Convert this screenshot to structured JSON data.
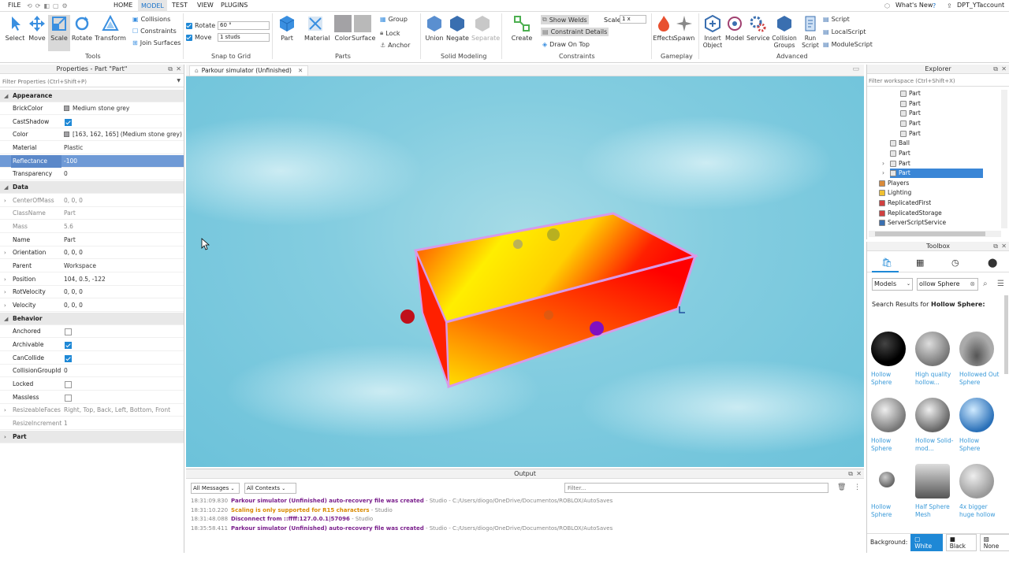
{
  "menu": {
    "file": "FILE",
    "home": "HOME",
    "model": "MODEL",
    "test": "TEST",
    "view": "VIEW",
    "plugins": "PLUGINS",
    "whats_new": "What's New",
    "account": "DPT_YTaccount"
  },
  "ribbon": {
    "tools": {
      "select": "Select",
      "move": "Move",
      "scale": "Scale",
      "rotate": "Rotate",
      "transform": "Transform",
      "collisions": "Collisions",
      "constraints": "Constraints",
      "join_surfaces": "Join Surfaces",
      "label": "Tools"
    },
    "snap": {
      "rotate_label": "Rotate",
      "rotate_value": "60 °",
      "move_label": "Move",
      "move_value": "1 studs",
      "label": "Snap to Grid"
    },
    "parts": {
      "part": "Part",
      "material": "Material",
      "color": "Color",
      "surface": "Surface",
      "group": "Group",
      "lock": "Lock",
      "anchor": "Anchor",
      "label": "Parts"
    },
    "solid": {
      "union": "Union",
      "negate": "Negate",
      "separate": "Separate",
      "label": "Solid Modeling"
    },
    "constraints": {
      "create": "Create",
      "show_welds": "Show Welds",
      "constraint_details": "Constraint Details",
      "draw_on_top": "Draw On Top",
      "scale_label": "Scale",
      "scale_value": "1 x",
      "label": "Constraints"
    },
    "gameplay": {
      "effects": "Effects",
      "spawn": "Spawn",
      "label": "Gameplay"
    },
    "advanced": {
      "insert_object": "Insert Object",
      "model": "Model",
      "service": "Service",
      "collision_groups": "Collision Groups",
      "run_script": "Run Script",
      "script": "Script",
      "local_script": "LocalScript",
      "module_script": "ModuleScript",
      "label": "Advanced"
    }
  },
  "properties": {
    "title": "Properties - Part \"Part\"",
    "filter_placeholder": "Filter Properties (Ctrl+Shift+P)",
    "appearance": "Appearance",
    "brickcolor_k": "BrickColor",
    "brickcolor_v": "Medium stone grey",
    "castshadow_k": "CastShadow",
    "color_k": "Color",
    "color_v": "[163, 162, 165] (Medium stone grey)",
    "material_k": "Material",
    "material_v": "Plastic",
    "reflectance_k": "Reflectance",
    "reflectance_v": "-100",
    "transparency_k": "Transparency",
    "transparency_v": "0",
    "data": "Data",
    "com_k": "CenterOfMass",
    "com_v": "0, 0, 0",
    "classname_k": "ClassName",
    "classname_v": "Part",
    "mass_k": "Mass",
    "mass_v": "5.6",
    "name_k": "Name",
    "name_v": "Part",
    "orientation_k": "Orientation",
    "orientation_v": "0, 0, 0",
    "parent_k": "Parent",
    "parent_v": "Workspace",
    "position_k": "Position",
    "position_v": "104, 0.5, -122",
    "rotvel_k": "RotVelocity",
    "rotvel_v": "0, 0, 0",
    "velocity_k": "Velocity",
    "velocity_v": "0, 0, 0",
    "behavior": "Behavior",
    "anchored_k": "Anchored",
    "archivable_k": "Archivable",
    "cancollide_k": "CanCollide",
    "cgid_k": "CollisionGroupId",
    "cgid_v": "0",
    "locked_k": "Locked",
    "massless_k": "Massless",
    "resizeable_k": "ResizeableFaces",
    "resizeable_v": "Right, Top, Back, Left, Bottom, Front",
    "resizeinc_k": "ResizeIncrement",
    "resizeinc_v": "1",
    "part": "Part"
  },
  "viewport": {
    "tab": "Parkour simulator (Unfinished)"
  },
  "output": {
    "title": "Output",
    "all_messages": "All Messages",
    "all_contexts": "All Contexts",
    "filter_placeholder": "Filter...",
    "lines": [
      {
        "time": "18:31:09.830",
        "msg": "Parkour simulator (Unfinished) auto-recovery file was created",
        "ctx": " - Studio - C:/Users/diogo/OneDrive/Documentos/ROBLOX/AutoSaves",
        "color": "#7a1f8c"
      },
      {
        "time": "18:31:10.220",
        "msg": "Scaling is only supported for R15 characters",
        "ctx": " - Studio",
        "color": "#d98a00"
      },
      {
        "time": "18:31:48.088",
        "msg": "Disconnect from ::ffff:127.0.0.1|57096",
        "ctx": " - Studio",
        "color": "#7a1f8c"
      },
      {
        "time": "18:35:58.411",
        "msg": "Parkour simulator (Unfinished) auto-recovery file was created",
        "ctx": " - Studio - C:/Users/diogo/OneDrive/Documentos/ROBLOX/AutoSaves",
        "color": "#7a1f8c"
      }
    ]
  },
  "explorer": {
    "title": "Explorer",
    "filter_placeholder": "Filter workspace (Ctrl+Shift+X)",
    "items": [
      "Part",
      "Part",
      "Part",
      "Part",
      "Part",
      "Ball",
      "Part",
      "Part",
      "Part",
      "Players",
      "Lighting",
      "ReplicatedFirst",
      "ReplicatedStorage",
      "ServerScriptService"
    ]
  },
  "toolbox": {
    "title": "Toolbox",
    "category": "Models",
    "search_value": "ollow Sphere",
    "results_prefix": "Search Results for",
    "results_term": "Hollow Sphere:",
    "items": [
      "Hollow Sphere",
      "High quality hollow...",
      "Hollowed Out Sphere",
      "Hollow Sphere",
      "Hollow Solid-mod...",
      "Hollow Sphere",
      "Hollow Sphere",
      "Half Sphere Mesh",
      "4x bigger huge hollow"
    ],
    "background_label": "Background:",
    "bg_white": "White",
    "bg_black": "Black",
    "bg_none": "None"
  }
}
